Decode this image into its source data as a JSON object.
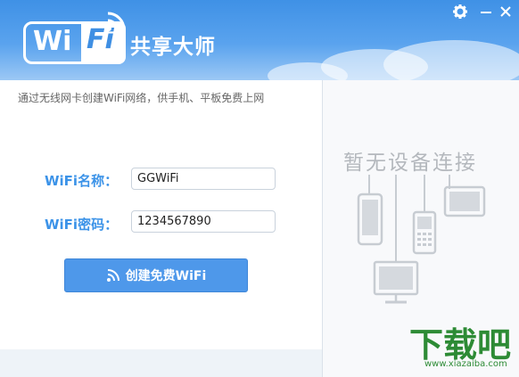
{
  "header": {
    "logo_wi": "Wi",
    "logo_fi": "Fi",
    "title": "共享大师"
  },
  "window_controls": [
    "settings-icon",
    "minimize-icon",
    "close-icon"
  ],
  "subtitle": "通过无线网卡创建WiFi网络，供手机、平板免费上网",
  "form": {
    "name_label": "WiFi名称：",
    "name_value": "GGWiFi",
    "password_label": "WiFi密码：",
    "password_value": "1234567890",
    "create_button": "创建免费WiFi"
  },
  "devices_panel": {
    "empty_text": "暂无设备连接",
    "icons": [
      "phone-icon",
      "feature-phone-icon",
      "tablet-icon",
      "monitor-icon"
    ]
  },
  "watermark": {
    "logo_text": "下载吧",
    "url": "www.xiazaiba.com"
  },
  "colors": {
    "header_blue": "#3f91e6",
    "label_blue": "#3c93e8",
    "button_blue": "#4e98ea",
    "watermark_green": "#2d8b35"
  }
}
